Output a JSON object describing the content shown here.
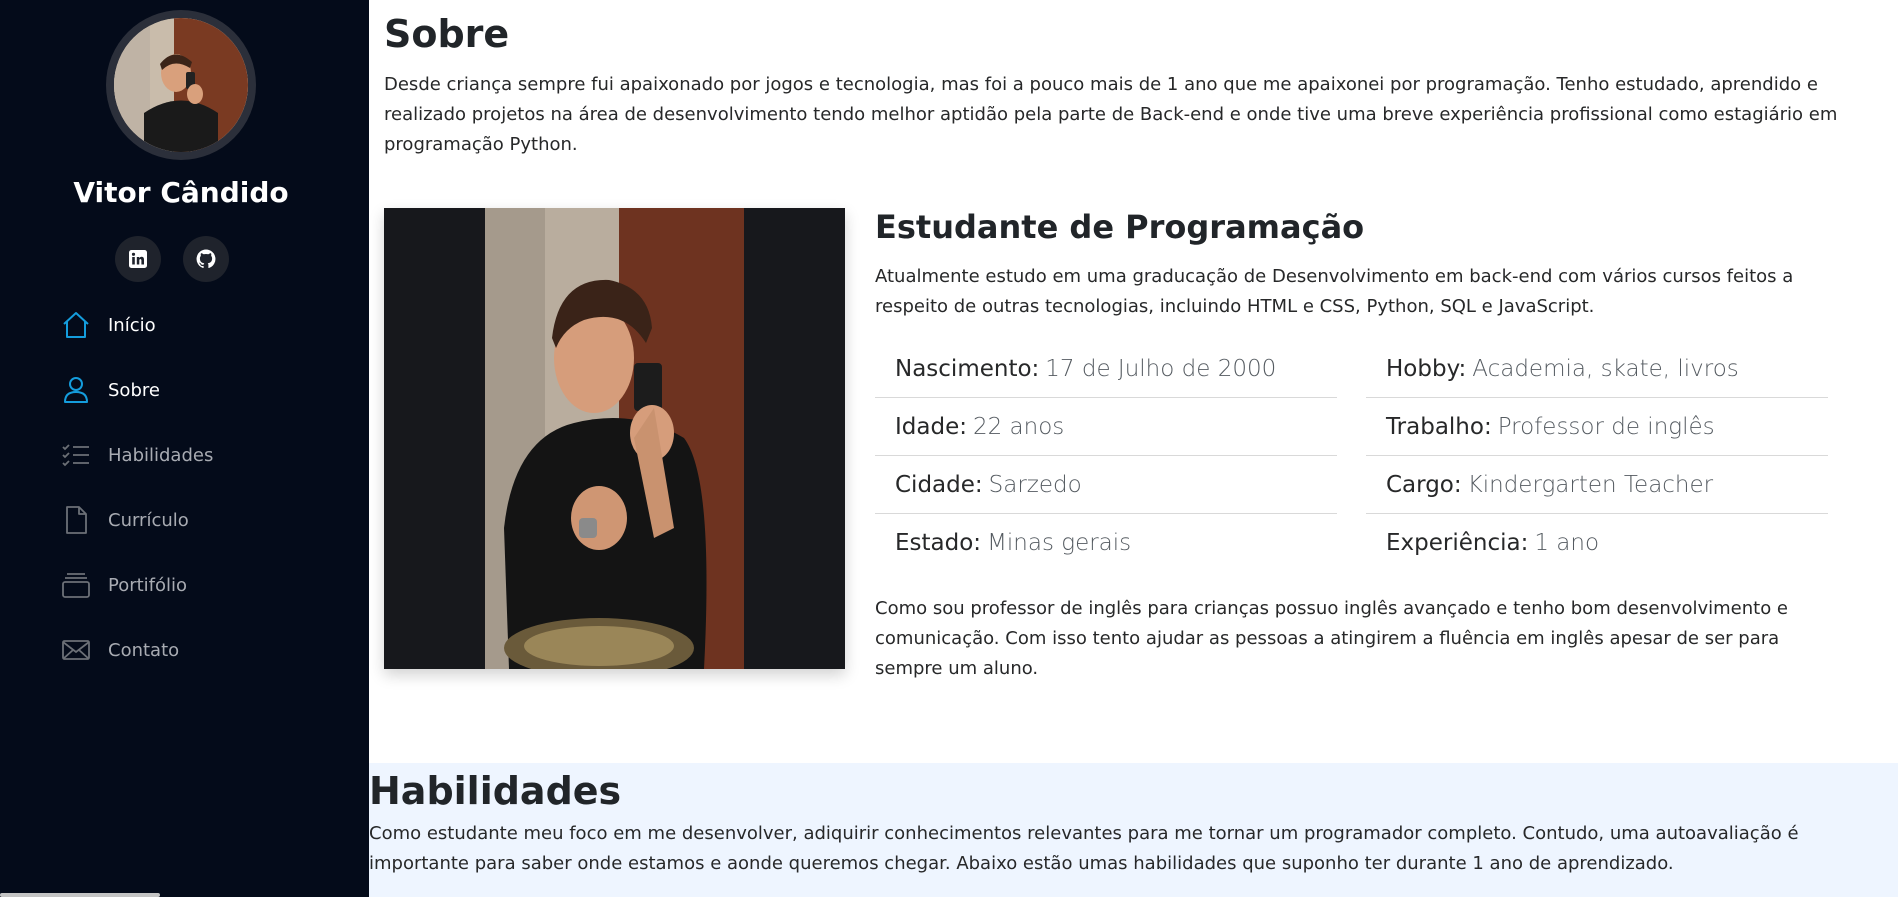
{
  "profile": {
    "name": "Vitor Cândido",
    "social": [
      {
        "icon": "linkedin-icon"
      },
      {
        "icon": "github-icon"
      }
    ]
  },
  "nav": {
    "items": [
      {
        "label": "Início",
        "icon": "home-icon"
      },
      {
        "label": "Sobre",
        "icon": "person-icon"
      },
      {
        "label": "Habilidades",
        "icon": "list-check-icon"
      },
      {
        "label": "Currículo",
        "icon": "file-icon"
      },
      {
        "label": "Portifólio",
        "icon": "collection-icon"
      },
      {
        "label": "Contato",
        "icon": "envelope-icon"
      }
    ],
    "accent_color": "#149ddd"
  },
  "about": {
    "title": "Sobre",
    "text": "Desde criança sempre fui apaixonado por jogos e tecnologia, mas foi a pouco mais de 1 ano que me apaixonei por programação. Tenho estudado, aprendido e realizado projetos na área de desenvolvimento tendo melhor aptidão pela parte de Back-end e onde tive uma breve experiência profissional como estagiário em programação Python.",
    "role_title": "Estudante de Programação",
    "role_text": "Atualmente estudo em uma graducação de Desenvolvimento em back-end com vários cursos feitos a respeito de outras tecnologias, incluindo HTML e CSS, Python, SQL e JavaScript.",
    "info_left": [
      {
        "key": "Nascimento:",
        "value": "17 de Julho de 2000"
      },
      {
        "key": "Idade:",
        "value": "22 anos"
      },
      {
        "key": "Cidade:",
        "value": "Sarzedo"
      },
      {
        "key": "Estado:",
        "value": "Minas gerais"
      }
    ],
    "info_right": [
      {
        "key": "Hobby:",
        "value": "Academia, skate, livros"
      },
      {
        "key": "Trabalho:",
        "value": "Professor de inglês"
      },
      {
        "key": "Cargo:",
        "value": "Kindergarten Teacher"
      },
      {
        "key": "Experiência:",
        "value": "1 ano"
      }
    ],
    "closing_text": "Como sou professor de inglês para crianças possuo inglês avançado e tenho bom desenvolvimento e comunicação. Com isso tento ajudar as pessoas a atingirem a fluência em inglês apesar de ser para sempre um aluno."
  },
  "skills": {
    "title": "Habilidades",
    "text": "Como estudante meu foco em me desenvolver, adiquirir conhecimentos relevantes para me tornar um programador completo. Contudo, uma autoavaliação é importante para saber onde estamos e aonde queremos chegar. Abaixo estão umas habilidades que suponho ter durante 1 ano de aprendizado."
  }
}
